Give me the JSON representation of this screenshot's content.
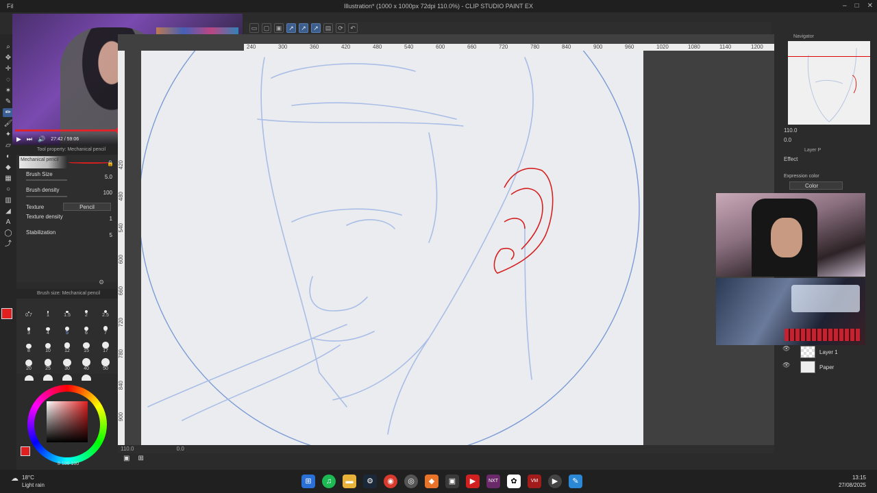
{
  "titlebar": {
    "app_short": "Fil",
    "title": "Illustration* (1000 x 1000px 72dpi 110.0%) - CLIP STUDIO PAINT EX"
  },
  "video": {
    "time": "27:42 / 59:06",
    "progress": 0.46
  },
  "tool_property": {
    "header": "Tool property: Mechanical pencil",
    "preset": "Mechanical pencil",
    "brush_size_label": "Brush Size",
    "brush_size": "5.0",
    "brush_density_label": "Brush density",
    "brush_density": "100",
    "texture_label": "Texture",
    "texture_value": "Pencil",
    "texture_density_label": "Texture density",
    "texture_density": "1",
    "stabilization_label": "Stabilization",
    "stabilization": "5"
  },
  "brush_size_panel": {
    "header": "Brush size: Mechanical pencil",
    "sizes": [
      "0.7",
      "1",
      "1.5",
      "2",
      "2.5",
      "3",
      "4",
      "5",
      "6",
      "7",
      "8",
      "10",
      "12",
      "15",
      "17",
      "20",
      "25",
      "30",
      "40",
      "50",
      "60",
      "70",
      "80",
      "100"
    ],
    "selected": "5"
  },
  "color_panel": {
    "footer": "8  100  100",
    "main_color": "#e02020"
  },
  "canvas": {
    "ruler_x": [
      "240",
      "300",
      "360",
      "420",
      "480",
      "540",
      "600",
      "660",
      "720",
      "780",
      "840",
      "900",
      "960",
      "1020",
      "1080",
      "1140",
      "1200"
    ],
    "ruler_y": [
      "420",
      "480",
      "540",
      "600",
      "660",
      "720",
      "780",
      "840",
      "900"
    ],
    "sketch_color": "#a9bde6",
    "ear_color": "#d42020",
    "zoom": "110.0",
    "angle": "0.0"
  },
  "navigator": {
    "title": "Navigator",
    "zoom": "110.0",
    "angle": "0.0"
  },
  "layer_property": {
    "title": "Layer P",
    "effect_label": "Effect",
    "expression_label": "Expression color",
    "expression_value": "Color"
  },
  "layers": [
    {
      "name": "Layer 1"
    },
    {
      "name": "Paper"
    }
  ],
  "taskbar": {
    "weather_temp": "18°C",
    "weather_desc": "Light rain",
    "time": "13:15",
    "date": "27/08/2025"
  }
}
